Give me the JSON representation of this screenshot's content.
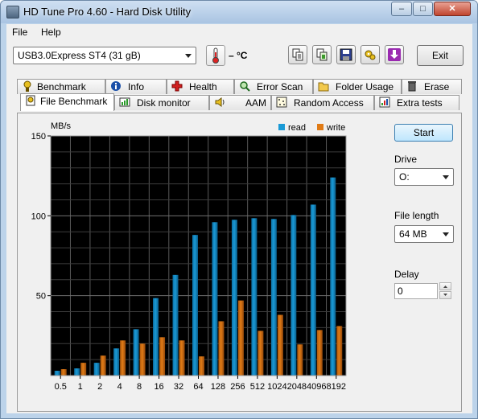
{
  "window": {
    "title": "HD Tune Pro 4.60 - Hard Disk Utility"
  },
  "title_buttons": {
    "minimize": "–",
    "maximize": "□",
    "close": "✕"
  },
  "menu": {
    "file": "File",
    "help": "Help"
  },
  "toolbar": {
    "drive_select": "USB3.0Express ST4 (31 gB)",
    "temperature": "– °C",
    "exit_label": "Exit",
    "icons": [
      "copy-info-icon",
      "copy-screenshot-icon",
      "save-icon",
      "options-icon",
      "download-icon"
    ]
  },
  "tabs_top": [
    {
      "label": "Benchmark",
      "icon": "benchmark-icon"
    },
    {
      "label": "Info",
      "icon": "info-icon"
    },
    {
      "label": "Health",
      "icon": "health-icon"
    },
    {
      "label": "Error Scan",
      "icon": "error-scan-icon"
    },
    {
      "label": "Folder Usage",
      "icon": "folder-icon"
    },
    {
      "label": "Erase",
      "icon": "erase-icon"
    }
  ],
  "tabs_bottom": [
    {
      "label": "File Benchmark",
      "icon": "file-benchmark-icon",
      "active": true
    },
    {
      "label": "Disk monitor",
      "icon": "disk-monitor-icon"
    },
    {
      "label": "AAM",
      "icon": "aam-icon"
    },
    {
      "label": "Random Access",
      "icon": "random-access-icon"
    },
    {
      "label": "Extra tests",
      "icon": "extra-tests-icon"
    }
  ],
  "side_panel": {
    "start_label": "Start",
    "drive_label": "Drive",
    "drive_value": "O:",
    "file_length_label": "File length",
    "file_length_value": "64 MB",
    "delay_label": "Delay",
    "delay_value": "0"
  },
  "chart_data": {
    "type": "bar",
    "ylabel": "MB/s",
    "ylim": [
      0,
      150
    ],
    "yticks": [
      50,
      100,
      150
    ],
    "categories": [
      "0.5",
      "1",
      "2",
      "4",
      "8",
      "16",
      "32",
      "64",
      "128",
      "256",
      "512",
      "1024",
      "2048",
      "4096",
      "8192"
    ],
    "series": [
      {
        "name": "read",
        "color": "#1a9ad6",
        "values": [
          3,
          4.5,
          8,
          17,
          29,
          48.5,
          63,
          88,
          96,
          97.5,
          98.5,
          98,
          100.5,
          107,
          124
        ]
      },
      {
        "name": "write",
        "color": "#e07b16",
        "values": [
          4,
          8,
          12.5,
          22,
          20,
          24,
          22,
          12,
          34,
          47,
          28,
          38,
          19.5,
          28.5,
          31
        ]
      }
    ],
    "background": "#000000",
    "grid": true,
    "legend_position": "top-right"
  }
}
